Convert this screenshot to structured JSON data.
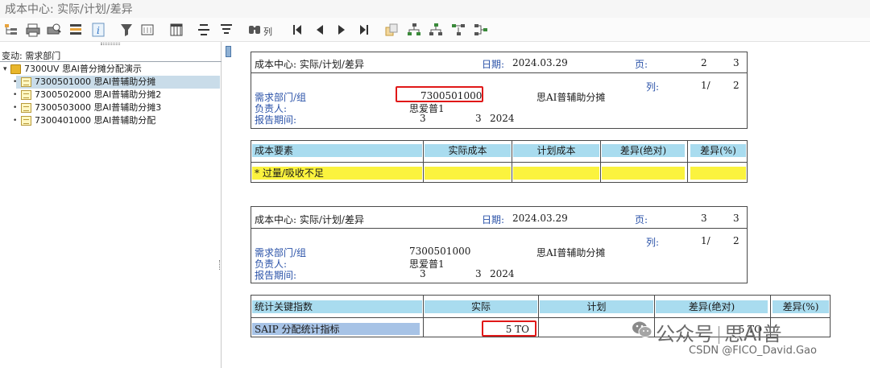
{
  "window_title": "成本中心: 实际/计划/差异",
  "toolbar": {
    "icons": [
      "tree-expand-icon",
      "print-icon",
      "print-preview-icon",
      "list-icon",
      "info-icon",
      "filter-icon",
      "layout-icon",
      "sum-icon",
      "sort-icon",
      "find-icon",
      "first-page-icon",
      "prev-page-icon",
      "next-page-icon",
      "last-page-icon",
      "copy-icon",
      "hierarchy-icon",
      "hierarchy-up-icon",
      "hierarchy-down-icon",
      "hierarchy-move-icon"
    ],
    "column_label": "列"
  },
  "tree": {
    "change_label": "变动: 需求部门",
    "root": {
      "code": "7300UV",
      "label": "7300UV 思AI普分摊分配演示"
    },
    "items": [
      {
        "label": "7300501000 思AI普辅助分摊",
        "selected": true
      },
      {
        "label": "7300502000 思AI普辅助分摊2",
        "selected": false
      },
      {
        "label": "7300503000 思AI普辅助分摊3",
        "selected": false
      },
      {
        "label": "7300401000 思AI普辅助分配",
        "selected": false
      }
    ]
  },
  "report1": {
    "header": {
      "title": "成本中心: 实际/计划/差异",
      "date_label": "日期:",
      "date_value": "2024.03.29",
      "page_label": "页:",
      "page_current": "2",
      "page_total": "3",
      "col_label": "列:",
      "col_current": "1/",
      "col_total": "2",
      "dept_label": "需求部门/组",
      "dept_value": "7300501000",
      "dept_name": "思AI普辅助分摊",
      "owner_label": "负责人:",
      "owner_value": "思爱普1",
      "period_label": "报告期间:",
      "period_from": "3",
      "period_to": "3",
      "period_year": "2024"
    },
    "table": {
      "headers": [
        "成本要素",
        "实际成本",
        "计划成本",
        "差异(绝对)",
        "差异(%)"
      ],
      "rows": [
        {
          "label": "* 过量/吸收不足",
          "values": [
            "",
            "",
            "",
            ""
          ]
        }
      ]
    }
  },
  "report2": {
    "header": {
      "title": "成本中心: 实际/计划/差异",
      "date_label": "日期:",
      "date_value": "2024.03.29",
      "page_label": "页:",
      "page_current": "3",
      "page_total": "3",
      "col_label": "列:",
      "col_current": "1/",
      "col_total": "2",
      "dept_label": "需求部门/组",
      "dept_value": "7300501000",
      "dept_name": "思AI普辅助分摊",
      "owner_label": "负责人:",
      "owner_value": "思爱普1",
      "period_label": "报告期间:",
      "period_from": "3",
      "period_to": "3",
      "period_year": "2024"
    },
    "table": {
      "headers": [
        "统计关键指数",
        "实际",
        "计划",
        "差异(绝对)",
        "差异(%)"
      ],
      "rows": [
        {
          "label": "SAIP  分配统计指标",
          "actual": "5  TO",
          "plan": "",
          "variance": "5  TO",
          "variance_pct": ""
        }
      ]
    }
  },
  "watermark": {
    "line1_left": "公众号",
    "line1_right": "思AI普",
    "line2": "CSDN @FICO_David.Gao"
  },
  "colors": {
    "header_fill": "#a9dcef",
    "highlight_fill": "#fbf33e",
    "label_blue": "#2a52a8",
    "callout_red": "#e01818"
  }
}
